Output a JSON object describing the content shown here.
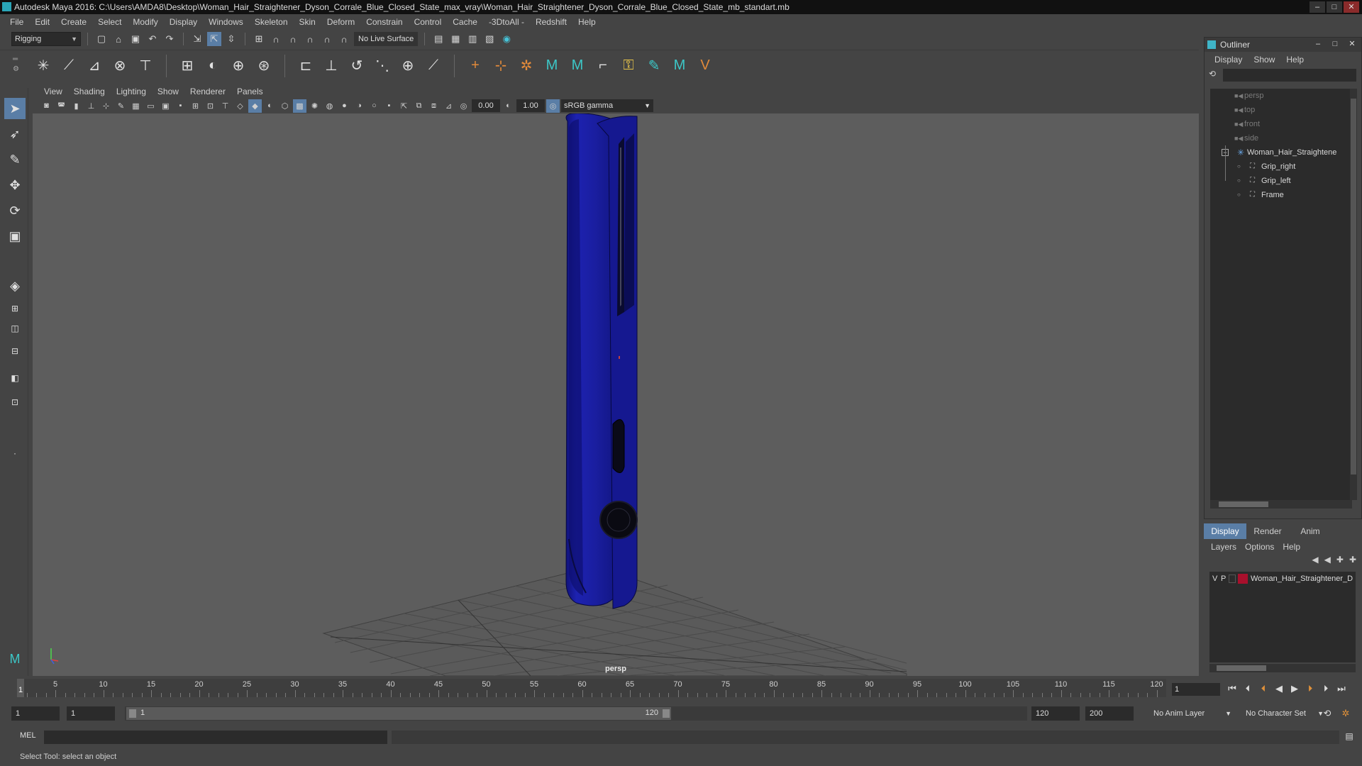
{
  "window": {
    "title": "Autodesk Maya 2016: C:\\Users\\AMDA8\\Desktop\\Woman_Hair_Straightener_Dyson_Corrale_Blue_Closed_State_max_vray\\Woman_Hair_Straightener_Dyson_Corrale_Blue_Closed_State_mb_standart.mb",
    "minimize": "–",
    "maximize": "□",
    "close": "✕"
  },
  "menubar": [
    "File",
    "Edit",
    "Create",
    "Select",
    "Modify",
    "Display",
    "Windows",
    "Skeleton",
    "Skin",
    "Deform",
    "Constrain",
    "Control",
    "Cache",
    "-3DtoAll -",
    "Redshift",
    "Help"
  ],
  "statusline": {
    "menuset": "Rigging",
    "live_surface": "No Live Surface"
  },
  "viewport": {
    "menu": [
      "View",
      "Shading",
      "Lighting",
      "Show",
      "Renderer",
      "Panels"
    ],
    "exposure": "0.00",
    "gamma_value": "1.00",
    "color_space": "sRGB gamma",
    "camera_label": "persp",
    "object_color": "#1a1ea0"
  },
  "outliner": {
    "title": "Outliner",
    "menu": [
      "Display",
      "Show",
      "Help"
    ],
    "cameras": [
      "persp",
      "top",
      "front",
      "side"
    ],
    "group": "Woman_Hair_Straightene",
    "children": [
      "Grip_right",
      "Grip_left",
      "Frame"
    ],
    "expand_glyph": "−"
  },
  "layers": {
    "tabs": [
      "Display",
      "Render",
      "Anim"
    ],
    "menu": [
      "Layers",
      "Options",
      "Help"
    ],
    "rows": [
      {
        "v": "V",
        "p": "P",
        "name": "Woman_Hair_Straightener_D",
        "color": "#a8102c"
      }
    ]
  },
  "timeline": {
    "labels": [
      "1",
      "5",
      "10",
      "15",
      "20",
      "25",
      "30",
      "35",
      "40",
      "45",
      "50",
      "55",
      "60",
      "65",
      "70",
      "75",
      "80",
      "85",
      "90",
      "95",
      "100",
      "105",
      "110",
      "115",
      "120"
    ],
    "current_frame": "1",
    "current_field": "1"
  },
  "range": {
    "start": "1",
    "playback_start": "1",
    "slider_start": "1",
    "slider_end": "120",
    "playback_end": "120",
    "end": "200",
    "anim_layer": "No Anim Layer",
    "character_set": "No Character Set"
  },
  "cmdline": {
    "label": "MEL"
  },
  "helpline": {
    "text": "Select Tool: select an object"
  }
}
